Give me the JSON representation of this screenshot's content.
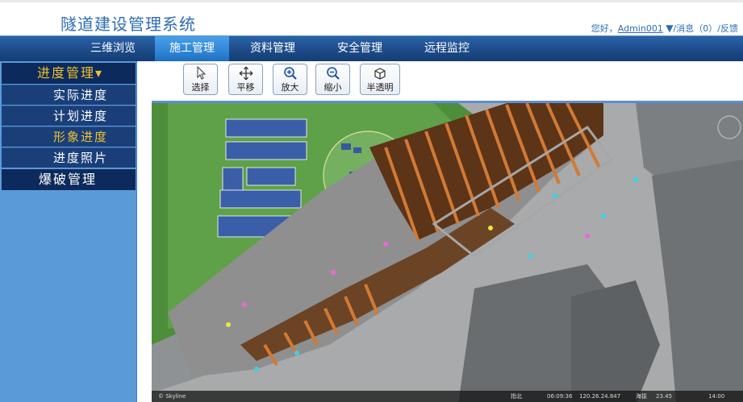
{
  "header": {
    "title": "隧道建设管理系统",
    "greeting": "您好，",
    "username": "Admin001",
    "dropdown_glyph": "▼",
    "messages": "/消息（0）",
    "feedback": "/反馈"
  },
  "nav": {
    "items": [
      {
        "label": "三维浏览"
      },
      {
        "label": "施工管理"
      },
      {
        "label": "资料管理"
      },
      {
        "label": "安全管理"
      },
      {
        "label": "远程监控"
      }
    ],
    "active_index": 1
  },
  "sidebar": {
    "group1": "进度管理▾",
    "items": [
      {
        "label": "实际进度"
      },
      {
        "label": "计划进度"
      },
      {
        "label": "形象进度"
      },
      {
        "label": "进度照片"
      }
    ],
    "active_index": 2,
    "group2": "爆破管理"
  },
  "toolbar": {
    "buttons": [
      {
        "label": "选择",
        "icon": "cursor-icon"
      },
      {
        "label": "平移",
        "icon": "pan-icon"
      },
      {
        "label": "放大",
        "icon": "zoom-in-icon"
      },
      {
        "label": "缩小",
        "icon": "zoom-out-icon"
      },
      {
        "label": "半透明",
        "icon": "transparent-cube-icon"
      }
    ]
  },
  "viewport": {
    "status": {
      "left": "© Skyline",
      "mid1": "指北",
      "mid2": "06:09:36",
      "mid3": "120.26.24.847",
      "mid4": "海拔",
      "mid5": "23.45",
      "mid6": "14:00"
    }
  },
  "colors": {
    "brand": "#2d6db5",
    "nav_dark": "#143d73",
    "nav_active": "#2f86d6",
    "sidebar_bg": "#5b9ad8",
    "sidebar_group": "#0c2a5c",
    "highlight": "#f0c030"
  }
}
